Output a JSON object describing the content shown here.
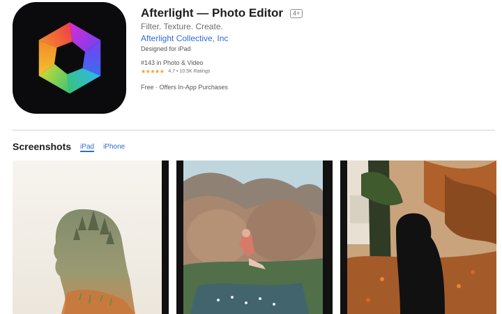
{
  "app": {
    "name": "Afterlight — Photo Editor",
    "age_rating": "4+",
    "subtitle": "Filter. Texture. Create.",
    "developer": "Afterlight Collective, Inc",
    "designed_for": "Designed for iPad",
    "rank": "#143 in Photo & Video",
    "stars": "★★★★★",
    "rating": "4.7 • 10.5K Ratings",
    "price": "Free · Offers In-App Purchases",
    "icon_colors": [
      "#d92cd2",
      "#7a3ff0",
      "#3a6df0",
      "#2fb6ef",
      "#38c47a",
      "#c9d934",
      "#f2c230",
      "#f28a2a",
      "#ee3f48"
    ]
  },
  "screenshots": {
    "heading": "Screenshots",
    "tabs": [
      {
        "label": "iPad",
        "active": true
      },
      {
        "label": "iPhone",
        "active": false
      }
    ],
    "items": [
      {
        "alt": "double-exposure-portrait"
      },
      {
        "alt": "person-sitting-on-rocks"
      },
      {
        "alt": "person-in-autumn-leaves"
      }
    ]
  },
  "colors": {
    "link": "#2f6bd6",
    "star": "#f0a02a",
    "divider": "#d2d2d7"
  }
}
